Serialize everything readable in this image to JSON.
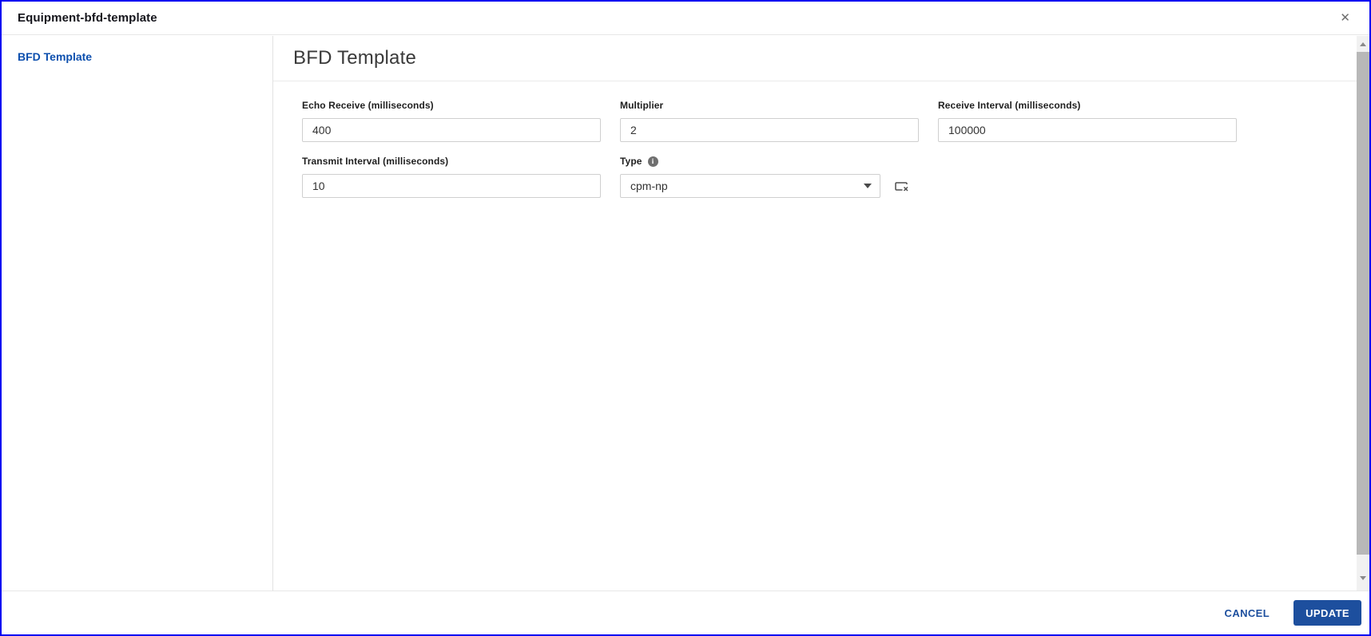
{
  "window": {
    "title": "Equipment-bfd-template"
  },
  "icons": {
    "close": "✕",
    "info_glyph": "i"
  },
  "sidebar": {
    "items": [
      {
        "label": "BFD Template",
        "active": true
      }
    ]
  },
  "main": {
    "heading": "BFD Template",
    "fields": [
      {
        "label": "Echo Receive (milliseconds)",
        "value": "400",
        "type": "text"
      },
      {
        "label": "Multiplier",
        "value": "2",
        "type": "text"
      },
      {
        "label": "Receive Interval (milliseconds)",
        "value": "100000",
        "type": "text"
      },
      {
        "label": "Transmit Interval (milliseconds)",
        "value": "10",
        "type": "text"
      },
      {
        "label": "Type",
        "value": "cpm-np",
        "type": "select",
        "has_info_icon": true,
        "has_clear_icon": true
      }
    ]
  },
  "footer": {
    "cancel": "CANCEL",
    "update": "UPDATE"
  },
  "colors": {
    "window_border": "#0101f2",
    "link_blue": "#0c4fae",
    "action_blue": "#1d4f9e"
  }
}
